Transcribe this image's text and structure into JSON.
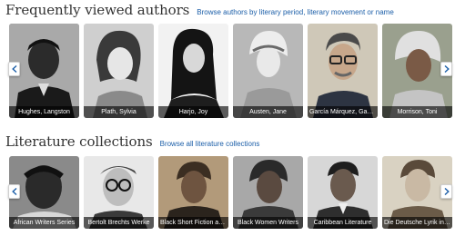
{
  "authors": {
    "title": "Frequently viewed authors",
    "link": "Browse authors by literary period, literary movement or name",
    "items": [
      {
        "name": "Hughes, Langston"
      },
      {
        "name": "Plath, Sylvia"
      },
      {
        "name": "Harjo, Joy"
      },
      {
        "name": "Austen, Jane"
      },
      {
        "name": "García Márquez, Gabriel"
      },
      {
        "name": "Morrison, Toni"
      }
    ]
  },
  "collections": {
    "title": "Literature collections",
    "link": "Browse all literature collections",
    "items": [
      {
        "name": "African Writers Series"
      },
      {
        "name": "Bertolt Brechts Werke"
      },
      {
        "name": "Black Short Fiction and ..."
      },
      {
        "name": "Black Women Writers"
      },
      {
        "name": "Caribbean Literature"
      },
      {
        "name": "Die Deutsche Lyrik in Re..."
      }
    ]
  },
  "icons": {
    "prev": "chevron-left-icon",
    "next": "chevron-right-icon"
  },
  "colors": {
    "link": "#1b5ea8",
    "title": "#333333",
    "caption_bg": "#000000"
  }
}
